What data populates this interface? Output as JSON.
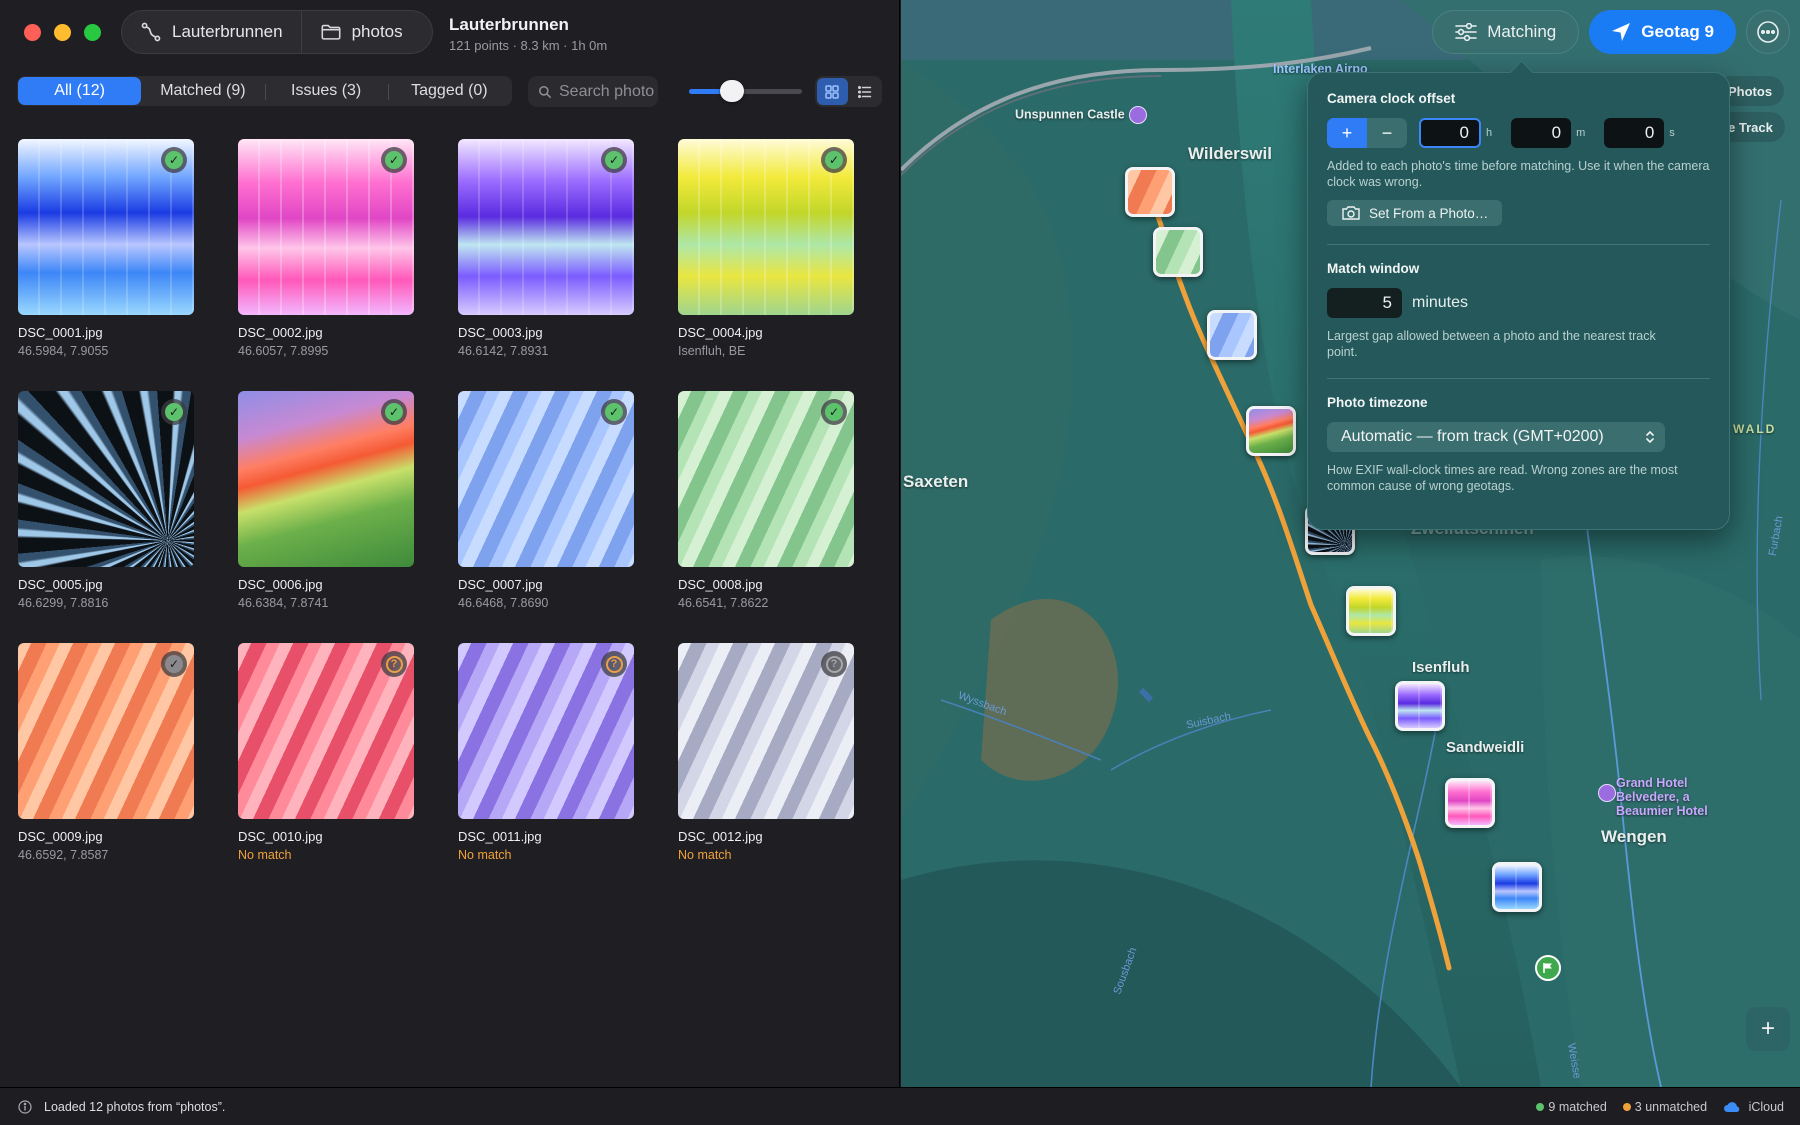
{
  "window": {
    "title": "Lauterbrunnen",
    "subtitle": "121 points · 8.3 km · 1h 0m"
  },
  "pathbar": {
    "track_label": "Lauterbrunnen",
    "folder_label": "photos"
  },
  "filters": [
    {
      "label": "All (12)",
      "active": true
    },
    {
      "label": "Matched (9)",
      "active": false
    },
    {
      "label": "Issues (3)",
      "active": false
    },
    {
      "label": "Tagged (0)",
      "active": false
    }
  ],
  "search": {
    "placeholder": "Search photos",
    "value": ""
  },
  "thumb_size": {
    "value": 0.38
  },
  "photos": [
    {
      "name": "DSC_0001.jpg",
      "detail": "46.5984, 7.9055",
      "status": "matched",
      "art": "pills-blue"
    },
    {
      "name": "DSC_0002.jpg",
      "detail": "46.6057, 7.8995",
      "status": "matched",
      "art": "pills-pink"
    },
    {
      "name": "DSC_0003.jpg",
      "detail": "46.6142, 7.8931",
      "status": "matched",
      "art": "pills-purple"
    },
    {
      "name": "DSC_0004.jpg",
      "detail": "Isenfluh, BE",
      "status": "matched",
      "art": "pills-yellow"
    },
    {
      "name": "DSC_0005.jpg",
      "detail": "46.6299, 7.8816",
      "status": "matched",
      "art": "fan"
    },
    {
      "name": "DSC_0006.jpg",
      "detail": "46.6384, 7.8741",
      "status": "matched",
      "art": "sonoma"
    },
    {
      "name": "DSC_0007.jpg",
      "detail": "46.6468, 7.8690",
      "status": "matched",
      "art": "waves-blue"
    },
    {
      "name": "DSC_0008.jpg",
      "detail": "46.6541, 7.8622",
      "status": "matched",
      "art": "waves-green"
    },
    {
      "name": "DSC_0009.jpg",
      "detail": "46.6592, 7.8587",
      "status": "matched-muted",
      "art": "waves-orange"
    },
    {
      "name": "DSC_0010.jpg",
      "detail": "No match",
      "status": "issue",
      "art": "waves-red"
    },
    {
      "name": "DSC_0011.jpg",
      "detail": "No match",
      "status": "issue",
      "art": "waves-violet"
    },
    {
      "name": "DSC_0012.jpg",
      "detail": "No match",
      "status": "issue-muted",
      "art": "waves-gray"
    }
  ],
  "toolbar": {
    "matching_label": "Matching",
    "geotag_label": "Geotag 9",
    "photos_chip": "Photos",
    "track_chip": "e Track"
  },
  "map": {
    "labels": {
      "wilderswil": "Wilderswil",
      "saxeten": "Saxeten",
      "isenfluh": "Isenfluh",
      "sandweidli": "Sandweidli",
      "wengen": "Wengen",
      "zweiluetschinen": "Zweilütschinen",
      "unspunnen": "Unspunnen Castle",
      "interlaken_airport": "Interlaken Airpo",
      "grand_hotel": "Grand Hotel Belvedere, a Beaumier Hotel",
      "wald": "WALD",
      "wyssbach": "Wyssbach",
      "suisbach": "Suisbach",
      "sousbach": "Sousbach",
      "furbach": "Furbach",
      "weisse": "Weisse"
    }
  },
  "popover": {
    "clock_title": "Camera clock offset",
    "sign_plus": "+",
    "sign_minus": "−",
    "hours": "0",
    "minutes": "0",
    "seconds": "0",
    "unit_h": "h",
    "unit_m": "m",
    "unit_s": "s",
    "clock_desc": "Added to each photo's time before matching. Use it when the camera clock was wrong.",
    "set_from_photo": "Set From a Photo…",
    "window_title": "Match window",
    "window_value": "5",
    "window_unit": "minutes",
    "window_desc": "Largest gap allowed between a photo and the nearest track point.",
    "tz_title": "Photo timezone",
    "tz_value": "Automatic — from track (GMT+0200)",
    "tz_desc": "How EXIF wall-clock times are read. Wrong zones are the most common cause of wrong geotags."
  },
  "status": {
    "message": "Loaded 12 photos from “photos”.",
    "matched": "9 matched",
    "unmatched": "3 unmatched",
    "cloud": "iCloud",
    "colors": {
      "matched": "#5cc36c",
      "unmatched": "#f0a23a",
      "cloud": "#3b8cf5"
    }
  }
}
